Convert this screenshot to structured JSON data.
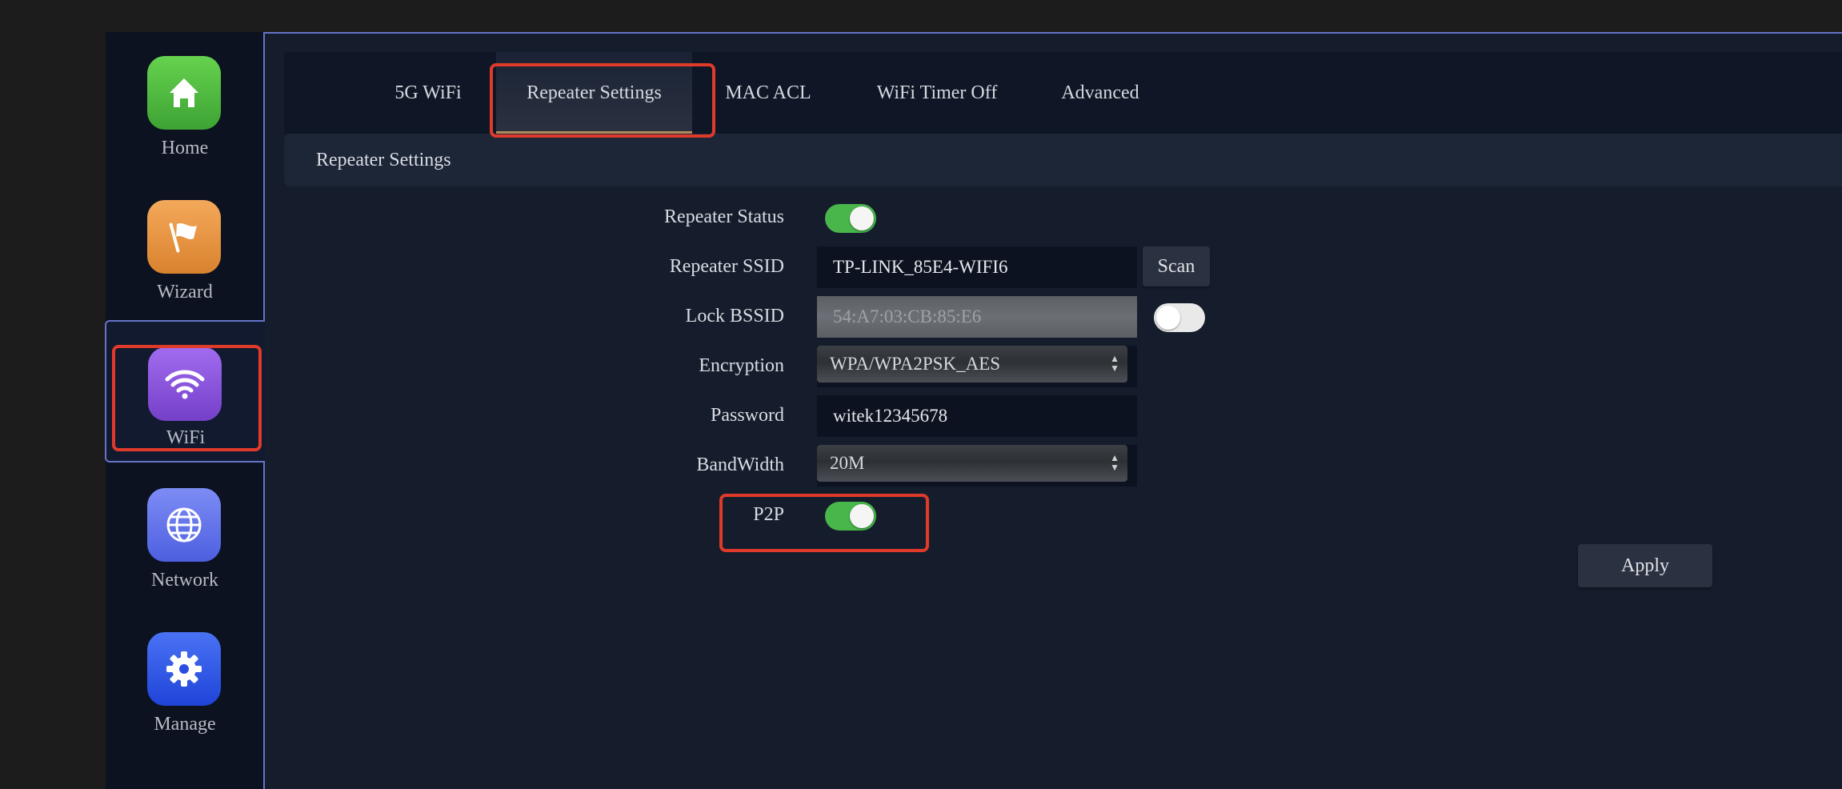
{
  "sidebar": {
    "items": [
      {
        "label": "Home",
        "icon": "home-icon",
        "color": "#4cb83c"
      },
      {
        "label": "Wizard",
        "icon": "flag-icon",
        "color": "#e8953c"
      },
      {
        "label": "WiFi",
        "icon": "wifi-icon",
        "color": "#8a58d8",
        "active": true
      },
      {
        "label": "Network",
        "icon": "globe-icon",
        "color": "#5e6fe8"
      },
      {
        "label": "Manage",
        "icon": "gear-icon",
        "color": "#2f56e6"
      }
    ]
  },
  "tabs": [
    {
      "label": "5G WiFi"
    },
    {
      "label": "Repeater Settings",
      "active": true
    },
    {
      "label": "MAC ACL"
    },
    {
      "label": "WiFi Timer Off"
    },
    {
      "label": "Advanced"
    }
  ],
  "section": {
    "title": "Repeater Settings"
  },
  "form": {
    "repeater_status": {
      "label": "Repeater Status",
      "state": "on"
    },
    "repeater_ssid": {
      "label": "Repeater SSID",
      "value": "TP-LINK_85E4-WIFI6",
      "scan_label": "Scan"
    },
    "lock_bssid": {
      "label": "Lock BSSID",
      "value": "54:A7:03:CB:85:E6",
      "toggle_state": "off"
    },
    "encryption": {
      "label": "Encryption",
      "value": "WPA/WPA2PSK_AES"
    },
    "password": {
      "label": "Password",
      "value": "witek12345678"
    },
    "bandwidth": {
      "label": "BandWidth",
      "value": "20M"
    },
    "p2p": {
      "label": "P2P",
      "state": "on"
    }
  },
  "apply_label": "Apply",
  "colors": {
    "toggle_on": "#48b64a",
    "highlight": "#e03a2a",
    "sidebar_bg": "#0c1220",
    "main_bg": "#151d2c"
  }
}
